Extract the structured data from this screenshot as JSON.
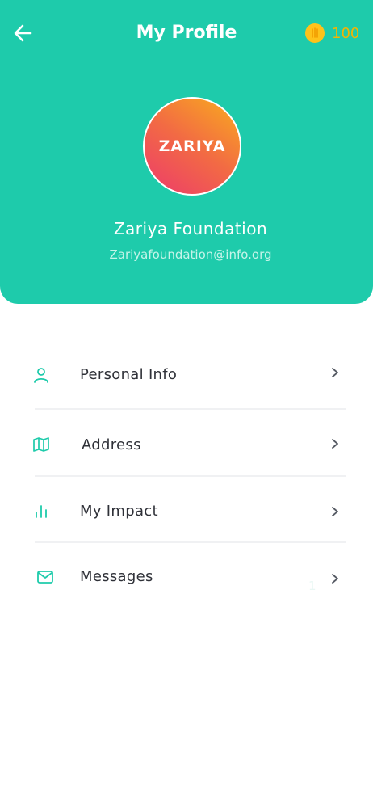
{
  "header": {
    "title": "My Profile",
    "coins": "100",
    "back_icon": "arrow-left-icon",
    "coin_icon": "coin-icon"
  },
  "profile": {
    "logo_text": "ZARIYA",
    "name": "Zariya Foundation",
    "email": "Zariyafoundation@info.org"
  },
  "menu": {
    "items": [
      {
        "label": "Personal Info",
        "icon": "user-icon"
      },
      {
        "label": "Address",
        "icon": "map-icon"
      },
      {
        "label": "My Impact",
        "icon": "bar-chart-icon"
      },
      {
        "label": "Messages",
        "icon": "mail-icon",
        "badge": "1"
      }
    ]
  },
  "colors": {
    "primary": "#1ecbab",
    "coin": "#f5b400",
    "text": "#2f3138",
    "avatar_gradient": [
      "#ed3a6c",
      "#f9ad1d"
    ]
  }
}
